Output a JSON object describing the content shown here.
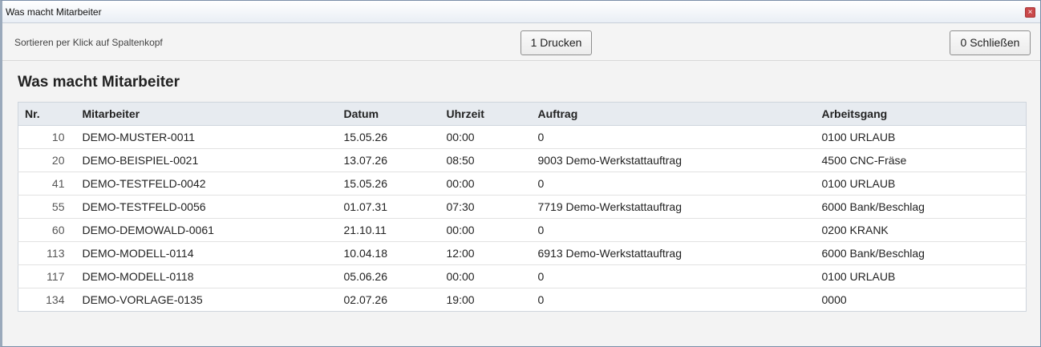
{
  "window": {
    "title": "Was macht Mitarbeiter",
    "close_symbol": "×"
  },
  "toolbar": {
    "hint": "Sortieren per Klick auf Spaltenkopf",
    "print_label": "1 Drucken",
    "close_label": "0 Schließen"
  },
  "page": {
    "title": "Was macht Mitarbeiter"
  },
  "table": {
    "headers": [
      "Nr.",
      "Mitarbeiter",
      "Datum",
      "Uhrzeit",
      "Auftrag",
      "Arbeitsgang"
    ],
    "rows": [
      [
        "10",
        "DEMO-MUSTER-0011",
        "15.05.26",
        "00:00",
        "0",
        "0100 URLAUB"
      ],
      [
        "20",
        "DEMO-BEISPIEL-0021",
        "13.07.26",
        "08:50",
        "9003 Demo-Werkstattauftrag",
        "4500 CNC-Fräse"
      ],
      [
        "41",
        "DEMO-TESTFELD-0042",
        "15.05.26",
        "00:00",
        "0",
        "0100 URLAUB"
      ],
      [
        "55",
        "DEMO-TESTFELD-0056",
        "01.07.31",
        "07:30",
        "7719 Demo-Werkstattauftrag",
        "6000 Bank/Beschlag"
      ],
      [
        "60",
        "DEMO-DEMOWALD-0061",
        "21.10.11",
        "00:00",
        "0",
        "0200 KRANK"
      ],
      [
        "113",
        "DEMO-MODELL-0114",
        "10.04.18",
        "12:00",
        "6913 Demo-Werkstattauftrag",
        "6000 Bank/Beschlag"
      ],
      [
        "117",
        "DEMO-MODELL-0118",
        "05.06.26",
        "00:00",
        "0",
        "0100 URLAUB"
      ],
      [
        "134",
        "DEMO-VORLAGE-0135",
        "02.07.26",
        "19:00",
        "0",
        "0000"
      ]
    ]
  }
}
